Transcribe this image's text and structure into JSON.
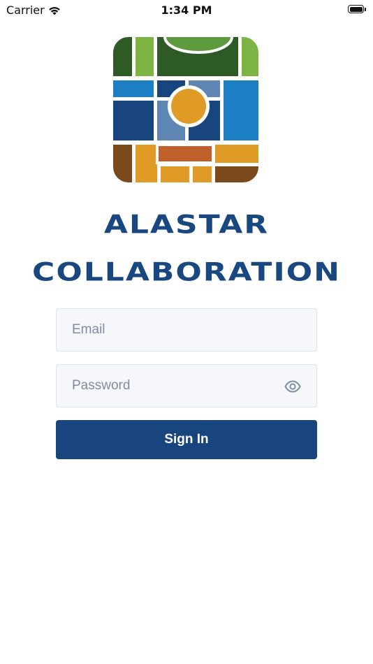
{
  "status_bar": {
    "carrier": "Carrier",
    "time": "1:34 PM"
  },
  "brand": {
    "line1": "ALASTAR",
    "line2": "COLLABORATION",
    "color": "#19477f"
  },
  "logo": {
    "icon": "alastar-map-grid-logo",
    "colors": [
      "#2d5a27",
      "#7cb342",
      "#5a9a3c",
      "#1f7fc4",
      "#19457f",
      "#5a84b0",
      "#2c2c54",
      "#e09b26",
      "#c0602a",
      "#7a4a1c"
    ]
  },
  "form": {
    "email_placeholder": "Email",
    "password_placeholder": "Password",
    "password_toggle_icon": "eye-icon",
    "sign_in_label": "Sign In",
    "accent": "#19457f"
  }
}
